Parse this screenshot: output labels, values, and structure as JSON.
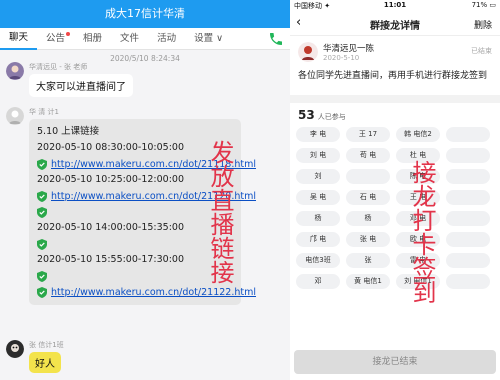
{
  "left": {
    "title": "成大17信计华清",
    "tabs": [
      {
        "label": "聊天"
      },
      {
        "label": "公告"
      },
      {
        "label": "相册"
      },
      {
        "label": "文件"
      },
      {
        "label": "活动"
      },
      {
        "label": "设置 ∨"
      }
    ],
    "timestamp": "2020/5/10 8:24:34",
    "messages": [
      {
        "sender": "华清远见 - 张 老师",
        "text": "大家可以进直播间了"
      },
      {
        "sender": "华 清 计1",
        "lines": [
          {
            "kind": "plain",
            "text": "5.10 上课链接"
          },
          {
            "kind": "plain",
            "text": "2020-05-10 08:30:00-10:05:00"
          },
          {
            "kind": "link",
            "text": "http://www.makeru.com.cn/dot/21118.html"
          },
          {
            "kind": "plain",
            "text": "2020-05-10 10:25:00-12:00:00"
          },
          {
            "kind": "link",
            "text": "http://www.makeru.com.cn/dot/21120.html"
          },
          {
            "kind": "blank",
            "text": ""
          },
          {
            "kind": "plain",
            "text": "2020-05-10 14:00:00-15:35:00"
          },
          {
            "kind": "blank",
            "text": ""
          },
          {
            "kind": "plain",
            "text": "2020-05-10 15:55:00-17:30:00"
          },
          {
            "kind": "blank",
            "text": ""
          },
          {
            "kind": "link",
            "text": "http://www.makeru.com.cn/dot/21122.html"
          }
        ]
      },
      {
        "sender": "张 信计1班",
        "text": "好人"
      }
    ],
    "annotation": "发放直播链接"
  },
  "right": {
    "status": {
      "carrier": "中国移动 ✦",
      "time": "11:01",
      "battery": "71% ▭"
    },
    "nav": {
      "back": "‹",
      "title": "群接龙详情",
      "delete": "删除"
    },
    "post": {
      "author": "华清远见一陈",
      "date": "2020-5-10",
      "tag": "已结束",
      "text": "各位同学先进直播间，再用手机进行群接龙签到"
    },
    "count": {
      "num": "53",
      "label": "人已参与"
    },
    "chips": [
      "李 电",
      "王 17",
      "韩 电信2",
      "",
      "刘 电",
      "苟 电",
      "杜 电",
      "",
      "刘 ",
      "",
      "陈 电",
      "",
      "吴 电",
      "石 电",
      "王 电",
      "",
      "杨 ",
      "杨 ",
      "邓 电",
      "",
      "邝 电",
      "张 电",
      "欧 电",
      "",
      "电信3班 ",
      "张 ",
      "雷 电",
      "",
      "邓 ",
      "黄 电信1",
      "刘 电信1",
      ""
    ],
    "annotation": "接龙打卡签到",
    "end_button": "接龙已结束"
  },
  "colors": {
    "accent": "#1e9bf0",
    "link": "#0b4fc4",
    "annotation": "#e2344a",
    "call": "#21b75a"
  }
}
